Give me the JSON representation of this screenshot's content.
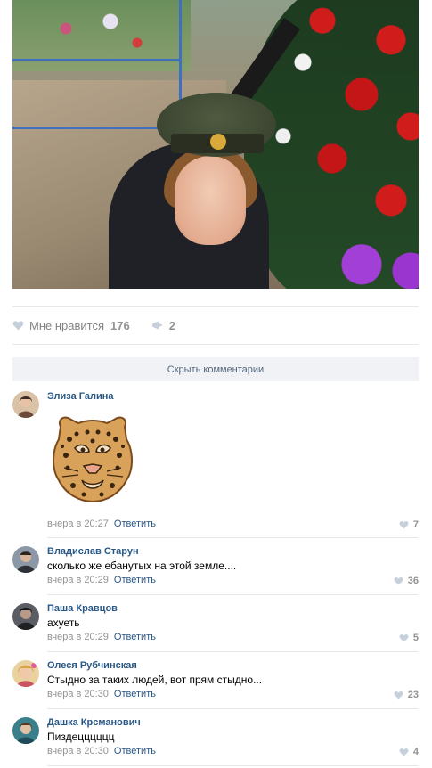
{
  "post": {
    "actions": {
      "like_label": "Мне нравится",
      "like_count": "176",
      "share_count": "2"
    },
    "hide_comments_label": "Скрыть комментарии"
  },
  "comments": [
    {
      "author": "Элиза Галина",
      "sticker": "leopard-sticker",
      "time": "вчера в 20:27",
      "reply_label": "Ответить",
      "likes": "7",
      "avatar_color": "#6b4a3a"
    },
    {
      "author": "Владислав Старун",
      "text": "сколько же ебанутых на этой земле....",
      "time": "вчера в 20:29",
      "reply_label": "Ответить",
      "likes": "36",
      "avatar_color": "#4a4f57"
    },
    {
      "author": "Паша Кравцов",
      "text": "ахуеть",
      "time": "вчера в 20:29",
      "reply_label": "Ответить",
      "likes": "5",
      "avatar_color": "#3b3e44"
    },
    {
      "author": "Олеся Рубчинская",
      "text": "Стыдно за таких людей, вот прям стыдно...",
      "time": "вчера в 20:30",
      "reply_label": "Ответить",
      "likes": "23",
      "avatar_color": "#d8a44a"
    },
    {
      "author": "Дашка Крсманович",
      "text": "Пиздецццццц",
      "time": "вчера в 20:30",
      "reply_label": "Ответить",
      "likes": "4",
      "avatar_color": "#3a7f8a"
    }
  ],
  "colors": {
    "link": "#2a5885",
    "muted": "#939393",
    "divider": "#e7e8ec",
    "button_bg": "#f0f2f5"
  }
}
